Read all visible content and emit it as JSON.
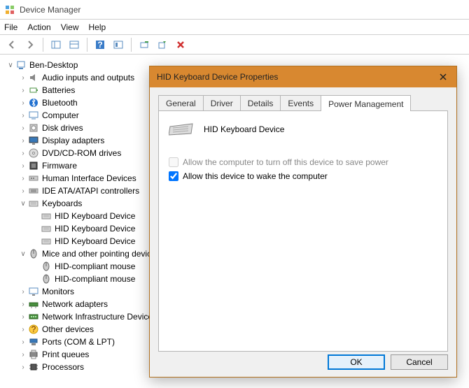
{
  "window": {
    "title": "Device Manager"
  },
  "menu": {
    "file": "File",
    "action": "Action",
    "view": "View",
    "help": "Help"
  },
  "toolbar_icons": {
    "back": "back-icon",
    "forward": "forward-icon",
    "properties": "properties-icon",
    "columns": "columns-icon",
    "help": "help-icon",
    "console": "console-icon",
    "scan": "scan-icon",
    "tree": "tree-icon",
    "uninstall": "uninstall-icon"
  },
  "tree": {
    "root": "Ben-Desktop",
    "categories": [
      {
        "label": "Audio inputs and outputs",
        "icon": "audio-icon"
      },
      {
        "label": "Batteries",
        "icon": "battery-icon"
      },
      {
        "label": "Bluetooth",
        "icon": "bluetooth-icon"
      },
      {
        "label": "Computer",
        "icon": "computer-icon"
      },
      {
        "label": "Disk drives",
        "icon": "disk-icon"
      },
      {
        "label": "Display adapters",
        "icon": "display-icon"
      },
      {
        "label": "DVD/CD-ROM drives",
        "icon": "dvd-icon"
      },
      {
        "label": "Firmware",
        "icon": "firmware-icon"
      },
      {
        "label": "Human Interface Devices",
        "icon": "hid-icon"
      },
      {
        "label": "IDE ATA/ATAPI controllers",
        "icon": "ide-icon"
      },
      {
        "label": "Keyboards",
        "icon": "keyboard-icon",
        "expanded": true,
        "children": [
          "HID Keyboard Device",
          "HID Keyboard Device",
          "HID Keyboard Device"
        ]
      },
      {
        "label": "Mice and other pointing devices",
        "icon": "mouse-icon",
        "expanded": true,
        "children": [
          "HID-compliant mouse",
          "HID-compliant mouse"
        ]
      },
      {
        "label": "Monitors",
        "icon": "monitor-icon"
      },
      {
        "label": "Network adapters",
        "icon": "network-icon"
      },
      {
        "label": "Network Infrastructure Devices",
        "icon": "netinfra-icon"
      },
      {
        "label": "Other devices",
        "icon": "other-icon"
      },
      {
        "label": "Ports (COM & LPT)",
        "icon": "ports-icon"
      },
      {
        "label": "Print queues",
        "icon": "print-icon"
      },
      {
        "label": "Processors",
        "icon": "cpu-icon"
      }
    ]
  },
  "dialog": {
    "title": "HID Keyboard Device Properties",
    "device_name": "HID Keyboard Device",
    "tabs": [
      "General",
      "Driver",
      "Details",
      "Events",
      "Power Management"
    ],
    "active_tab": "Power Management",
    "opt_turnoff": "Allow the computer to turn off this device to save power",
    "opt_wake": "Allow this device to wake the computer",
    "turnoff_checked": false,
    "turnoff_enabled": false,
    "wake_checked": true,
    "ok": "OK",
    "cancel": "Cancel"
  }
}
